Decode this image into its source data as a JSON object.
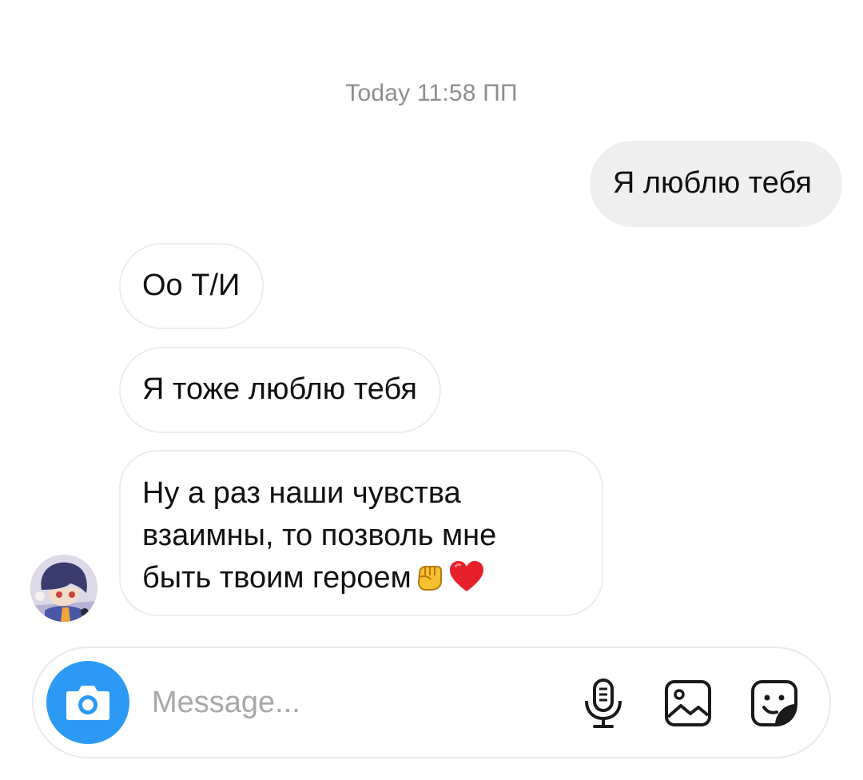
{
  "conversation": {
    "timestamp": "Today 11:58 ПП",
    "messages": [
      {
        "direction": "outgoing",
        "text": "Я люблю тебя"
      },
      {
        "direction": "incoming",
        "text": "Оо Т/И"
      },
      {
        "direction": "incoming",
        "text": "Я тоже люблю тебя"
      },
      {
        "direction": "incoming",
        "text": "Ну а раз наши чувства взаимны, то позволь мне быть твоим героем",
        "emoji": [
          "raised-fist-emoji",
          "red-heart-emoji"
        ]
      }
    ]
  },
  "composer": {
    "placeholder": "Message...",
    "icons": [
      "camera-icon",
      "microphone-icon",
      "gallery-icon",
      "sticker-icon"
    ],
    "accent_color": "#2c9af5"
  }
}
